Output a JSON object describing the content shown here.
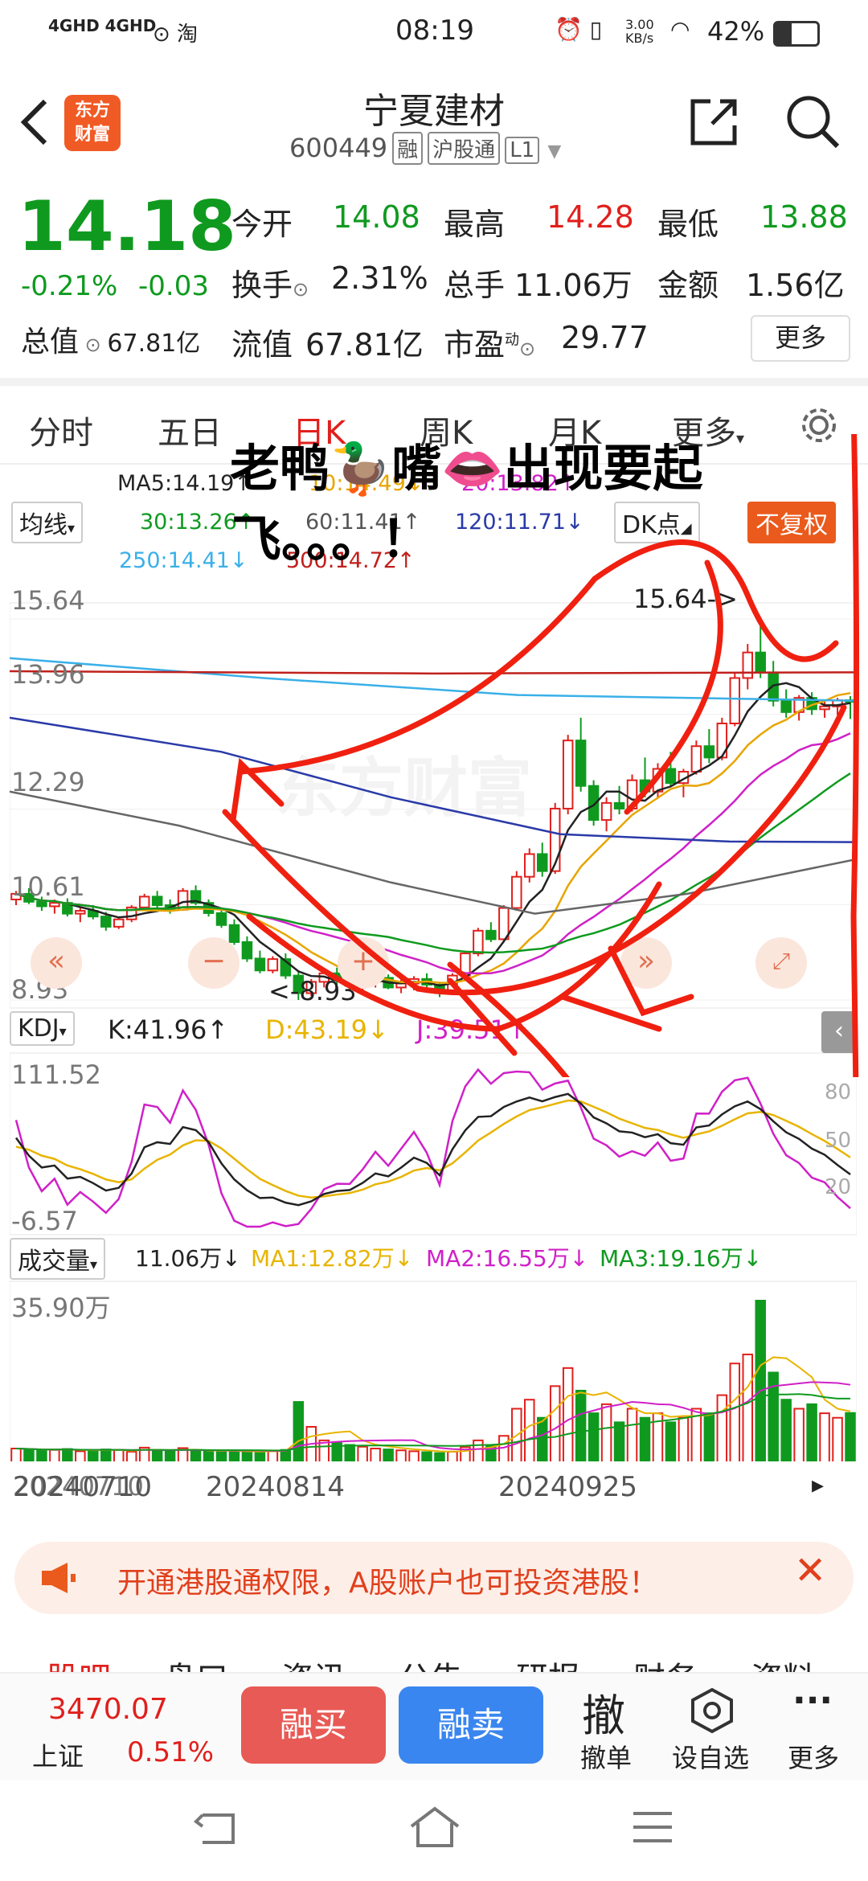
{
  "status_bar": {
    "network": "4GHD 4GHD",
    "time": "08:19",
    "speed": "3.00\nKB/s",
    "battery": "42%"
  },
  "header": {
    "title": "宁夏建材",
    "code": "600449",
    "tags": [
      "融",
      "沪股通",
      "L1"
    ],
    "logo_line1": "东方",
    "logo_line2": "财富"
  },
  "quote": {
    "price": "14.18",
    "change_pct": "-0.21%",
    "change": "-0.03",
    "open_label": "今开",
    "open": "14.08",
    "high_label": "最高",
    "high": "14.28",
    "low_label": "最低",
    "low": "13.88",
    "turnover_label": "换手",
    "turnover": "2.31%",
    "volume_label": "总手",
    "volume": "11.06万",
    "amount_label": "金额",
    "amount": "1.56亿",
    "mktcap_label": "总值",
    "mktcap": "67.81亿",
    "float_label": "流值",
    "float": "67.81亿",
    "pe_label": "市盈",
    "pe_sup": "动",
    "pe": "29.77",
    "more": "更多"
  },
  "tabs": [
    "分时",
    "五日",
    "日K",
    "周K",
    "月K",
    "更多"
  ],
  "ma": {
    "selector": "均线",
    "ma5": "MA5:14.19↑",
    "ma10": "10:14.49↓",
    "ma20": "20:13.82↑",
    "ma30": "30:13.26↑",
    "ma60": "60:11.41↑",
    "ma120": "120:11.71↓",
    "ma250": "250:14.41↓",
    "ma500": "500:14.72↑",
    "dk": "DK点",
    "adjust": "不复权"
  },
  "overlay": {
    "line1": "老鸭🦆嘴👄出现要起",
    "line2": "飞。。。！"
  },
  "price_axis": [
    "15.64",
    "13.96",
    "12.29",
    "10.61",
    "8.93"
  ],
  "annotations": {
    "high_mark": "15.64->",
    "low_mark": "<-8.93"
  },
  "kdj": {
    "label": "KDJ",
    "k": "K:41.96↑",
    "d": "D:43.19↓",
    "j": "J:39.51↑",
    "axis_top": "111.52",
    "axis_bottom": "-6.57",
    "lv80": "80",
    "lv50": "50",
    "lv20": "20"
  },
  "volume": {
    "label": "成交量",
    "value": "11.06万↓",
    "ma1": "MA1:12.82万↓",
    "ma2": "MA2:16.55万↓",
    "ma3": "MA3:19.16万↓",
    "axis_top": "35.90万"
  },
  "dates": [
    "20240710",
    "20240814",
    "20240925"
  ],
  "banner": {
    "text": "开通港股通权限，A股账户也可投资港股！"
  },
  "bottom_tabs": [
    "股吧",
    "盘口",
    "资讯",
    "公告",
    "研报",
    "财务",
    "资料"
  ],
  "index": {
    "value": "3470.07",
    "name": "上证",
    "pct": "0.51%"
  },
  "actions": {
    "buy": "融买",
    "sell": "融卖",
    "cancel": "撤单",
    "cancel_glyph": "撤",
    "watch": "设自选",
    "more": "更多"
  },
  "colors": {
    "up": "#e0201c",
    "down": "#0f9a1f",
    "buy": "#e85a55",
    "sell": "#3a86f0"
  },
  "chart_data": {
    "type": "candlestick",
    "y_range": [
      8.93,
      15.64
    ],
    "candles": [
      [
        10.7,
        10.85,
        10.6,
        10.8
      ],
      [
        10.8,
        10.9,
        10.62,
        10.66
      ],
      [
        10.66,
        10.75,
        10.5,
        10.58
      ],
      [
        10.58,
        10.7,
        10.45,
        10.64
      ],
      [
        10.64,
        10.72,
        10.4,
        10.45
      ],
      [
        10.45,
        10.55,
        10.3,
        10.5
      ],
      [
        10.5,
        10.6,
        10.35,
        10.4
      ],
      [
        10.4,
        10.48,
        10.15,
        10.22
      ],
      [
        10.22,
        10.4,
        10.18,
        10.35
      ],
      [
        10.35,
        10.6,
        10.3,
        10.56
      ],
      [
        10.56,
        10.8,
        10.5,
        10.75
      ],
      [
        10.75,
        10.85,
        10.55,
        10.6
      ],
      [
        10.6,
        10.7,
        10.45,
        10.52
      ],
      [
        10.52,
        10.9,
        10.5,
        10.85
      ],
      [
        10.85,
        10.95,
        10.6,
        10.64
      ],
      [
        10.64,
        10.7,
        10.4,
        10.46
      ],
      [
        10.46,
        10.55,
        10.2,
        10.25
      ],
      [
        10.25,
        10.35,
        9.9,
        9.95
      ],
      [
        9.95,
        10.05,
        9.6,
        9.66
      ],
      [
        9.66,
        9.8,
        9.4,
        9.45
      ],
      [
        9.45,
        9.7,
        9.4,
        9.65
      ],
      [
        9.65,
        9.75,
        9.3,
        9.36
      ],
      [
        9.36,
        9.45,
        8.93,
        9.05
      ],
      [
        9.05,
        9.3,
        9.0,
        9.25
      ],
      [
        9.25,
        9.45,
        9.15,
        9.4
      ],
      [
        9.4,
        9.5,
        9.2,
        9.28
      ],
      [
        9.28,
        9.4,
        9.1,
        9.18
      ],
      [
        9.18,
        9.32,
        9.05,
        9.25
      ],
      [
        9.25,
        9.4,
        9.15,
        9.32
      ],
      [
        9.32,
        9.38,
        9.12,
        9.15
      ],
      [
        9.15,
        9.3,
        9.05,
        9.22
      ],
      [
        9.22,
        9.35,
        9.1,
        9.3
      ],
      [
        9.3,
        9.4,
        9.15,
        9.2
      ],
      [
        9.2,
        9.25,
        8.98,
        9.05
      ],
      [
        9.05,
        9.4,
        9.02,
        9.36
      ],
      [
        9.36,
        9.8,
        9.3,
        9.75
      ],
      [
        9.75,
        10.2,
        9.7,
        10.15
      ],
      [
        10.15,
        10.3,
        9.95,
        10.0
      ],
      [
        10.0,
        10.6,
        9.95,
        10.55
      ],
      [
        10.55,
        11.2,
        10.5,
        11.1
      ],
      [
        11.1,
        11.6,
        11.0,
        11.5
      ],
      [
        11.5,
        11.7,
        11.1,
        11.2
      ],
      [
        11.2,
        12.4,
        11.15,
        12.3
      ],
      [
        12.3,
        13.6,
        12.2,
        13.5
      ],
      [
        13.5,
        13.9,
        12.6,
        12.7
      ],
      [
        12.7,
        12.8,
        12.0,
        12.1
      ],
      [
        12.1,
        12.5,
        11.9,
        12.4
      ],
      [
        12.4,
        12.7,
        12.2,
        12.3
      ],
      [
        12.3,
        12.9,
        12.25,
        12.8
      ],
      [
        12.8,
        13.2,
        12.5,
        12.6
      ],
      [
        12.6,
        13.1,
        12.5,
        13.0
      ],
      [
        13.0,
        13.3,
        12.7,
        12.75
      ],
      [
        12.75,
        13.0,
        12.5,
        12.95
      ],
      [
        12.95,
        13.5,
        12.9,
        13.4
      ],
      [
        13.4,
        13.7,
        13.1,
        13.2
      ],
      [
        13.2,
        13.9,
        13.15,
        13.8
      ],
      [
        13.8,
        14.7,
        13.75,
        14.6
      ],
      [
        14.6,
        15.2,
        14.4,
        15.05
      ],
      [
        15.05,
        15.64,
        14.6,
        14.7
      ],
      [
        14.7,
        14.9,
        14.1,
        14.2
      ],
      [
        14.2,
        14.4,
        13.9,
        14.0
      ],
      [
        14.0,
        14.3,
        13.85,
        14.25
      ],
      [
        14.25,
        14.35,
        13.95,
        14.05
      ],
      [
        14.05,
        14.2,
        13.9,
        14.1
      ],
      [
        14.1,
        14.25,
        13.95,
        14.21
      ],
      [
        14.21,
        14.28,
        13.88,
        14.18
      ]
    ],
    "volumes": [
      3.2,
      3.0,
      2.8,
      2.9,
      3.1,
      2.6,
      2.7,
      3.0,
      2.9,
      2.5,
      3.4,
      2.8,
      2.6,
      3.3,
      2.7,
      2.5,
      2.4,
      2.6,
      2.8,
      2.5,
      2.6,
      2.9,
      13.5,
      8.0,
      5.0,
      4.5,
      4.0,
      3.6,
      3.2,
      3.0,
      2.8,
      2.6,
      2.4,
      2.2,
      2.5,
      3.5,
      5.0,
      4.0,
      6.0,
      12.0,
      14.0,
      10.0,
      17.0,
      21.0,
      16.0,
      11.0,
      13.0,
      9.0,
      12.0,
      10.0,
      11.0,
      9.0,
      10.0,
      12.0,
      11.0,
      15.0,
      22.0,
      24.0,
      35.9,
      20.0,
      14.0,
      12.0,
      13.0,
      11.0,
      10.0,
      11.06
    ],
    "y_ticks": [
      15.64,
      13.96,
      12.29,
      10.61,
      8.93
    ],
    "kdj_range": [
      -6.57,
      111.52
    ],
    "volume_max": 35.9
  }
}
